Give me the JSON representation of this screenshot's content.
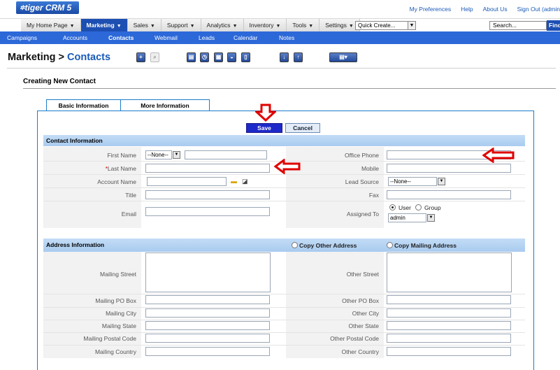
{
  "app": {
    "logo_text": "tiger CRM 5",
    "top_links": [
      "My Preferences",
      "Help",
      "About Us",
      "Sign Out (admin"
    ]
  },
  "nav": {
    "tabs": [
      {
        "label": "My Home Page",
        "caret": true
      },
      {
        "label": "Marketing",
        "caret": true,
        "active": true
      },
      {
        "label": "Sales",
        "caret": true
      },
      {
        "label": "Support",
        "caret": true
      },
      {
        "label": "Analytics",
        "caret": true
      },
      {
        "label": "Inventory",
        "caret": true
      },
      {
        "label": "Tools",
        "caret": true
      },
      {
        "label": "Settings",
        "caret": true
      }
    ],
    "quick_create": "Quick Create...",
    "search_value": "Search...",
    "find_label": "Find"
  },
  "subnav": {
    "items": [
      "Campaigns",
      "Accounts",
      "Contacts",
      "Webmail",
      "Leads",
      "Calendar",
      "Notes"
    ],
    "active": "Contacts"
  },
  "page": {
    "title_module": "Marketing >",
    "title_link": "Contacts",
    "subtitle": "Creating New Contact"
  },
  "form": {
    "tabs": [
      "Basic Information",
      "More Information"
    ],
    "save_label": "Save",
    "cancel_label": "Cancel",
    "contact_section": "Contact Information",
    "address_section": "Address Information",
    "copy_other": "Copy Other Address",
    "copy_mailing": "Copy Mailing Address",
    "labels": {
      "first_name": "First Name",
      "last_name_req": "*",
      "last_name": "Last Name",
      "account_name": "Account Name",
      "title": "Title",
      "email": "Email",
      "office_phone": "Office Phone",
      "mobile": "Mobile",
      "lead_source": "Lead Source",
      "fax": "Fax",
      "assigned_to": "Assigned To",
      "mailing_street": "Mailing Street",
      "other_street": "Other Street",
      "mailing_po_box": "Mailing PO Box",
      "other_po_box": "Other PO Box",
      "mailing_city": "Mailing City",
      "other_city": "Other City",
      "mailing_state": "Mailing State",
      "other_state": "Other State",
      "mailing_postal": "Mailing Postal Code",
      "other_postal": "Other Postal Code",
      "mailing_country": "Mailing Country",
      "other_country": "Other Country"
    },
    "values": {
      "salutation": "--None--",
      "lead_source": "--None--",
      "assigned_user": "admin",
      "user_label": "User",
      "group_label": "Group"
    }
  },
  "colors": {
    "nav_active": "#1d4fb3",
    "subnav_bg": "#2c68d8",
    "section_bg": "#b6d3f2",
    "annotation_arrow": "#e00000"
  }
}
